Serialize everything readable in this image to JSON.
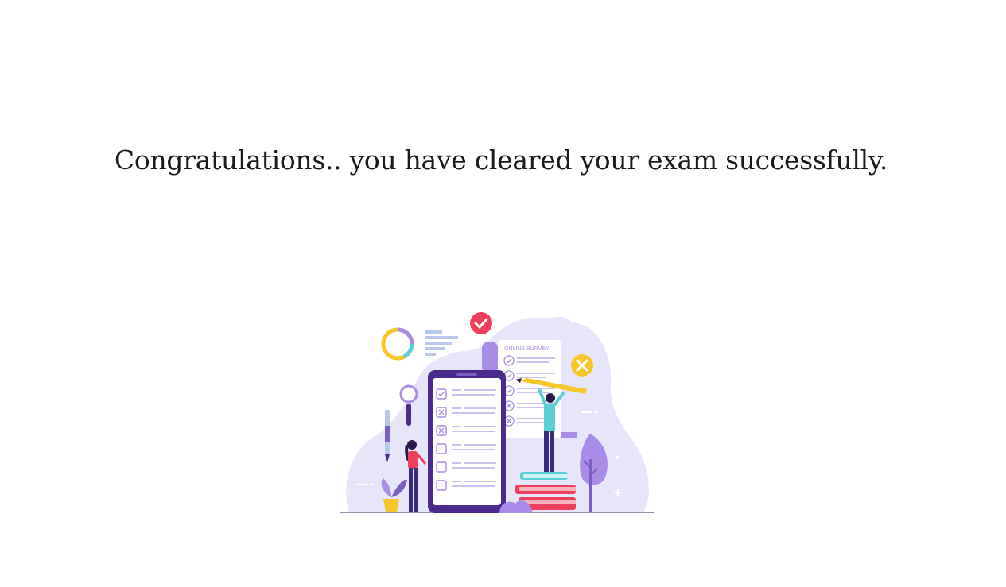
{
  "message": {
    "text": "Congratulations.. you have cleared your exam successfully."
  },
  "illustration": {
    "survey_label": "ONLINE SURVEY",
    "colors": {
      "blob": "#e7e5f9",
      "purple": "#5b2ea6",
      "light_purple": "#a98be8",
      "red": "#ef3e5c",
      "yellow": "#f6c62b",
      "teal": "#5ad0d6",
      "ground": "#6b6b8a"
    }
  }
}
